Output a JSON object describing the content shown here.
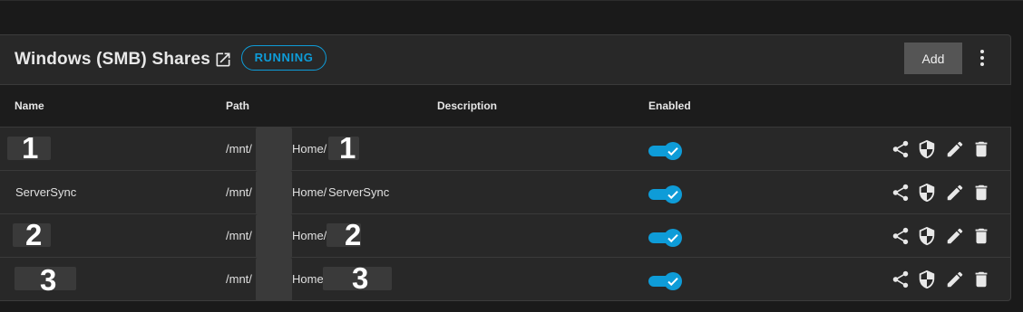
{
  "card": {
    "title": "Windows (SMB) Shares",
    "status_badge": "RUNNING",
    "add_label": "Add"
  },
  "columns": {
    "name": "Name",
    "path": "Path",
    "description": "Description",
    "enabled": "Enabled"
  },
  "rows": [
    {
      "name": "",
      "name_marker": "1",
      "path_prefix": "/mnt/",
      "path_mid": "Home/",
      "path_suffix": "",
      "path_marker": "1",
      "description": "",
      "enabled": true
    },
    {
      "name": "ServerSync",
      "name_marker": "",
      "path_prefix": "/mnt/",
      "path_mid": "Home/",
      "path_suffix": "ServerSync",
      "path_marker": "",
      "description": "",
      "enabled": true
    },
    {
      "name": "",
      "name_marker": "2",
      "path_prefix": "/mnt/",
      "path_mid": "Home/",
      "path_suffix": "",
      "path_marker": "2",
      "description": "",
      "enabled": true
    },
    {
      "name": "",
      "name_marker": "3",
      "path_prefix": "/mnt/",
      "path_mid": "Home",
      "path_suffix": "",
      "path_marker": "3",
      "description": "",
      "enabled": true
    }
  ],
  "icons": {
    "external_link": "open-in-new-icon",
    "more": "more-vert-icon",
    "share": "share-icon",
    "acl": "shield-icon",
    "edit": "pencil-icon",
    "delete": "trash-icon"
  },
  "colors": {
    "accent": "#0e9cd8",
    "background": "#1a1a1a",
    "card": "#282828"
  }
}
